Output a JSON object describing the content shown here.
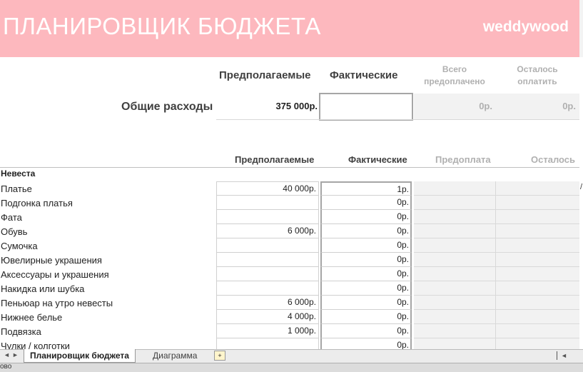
{
  "app": {
    "title": "ПЛАНИРОВЩИК БЮДЖЕТА",
    "brand": "weddywood",
    "banner_color": "#fdb8be"
  },
  "summary": {
    "col_planned": "Предполагаемые",
    "col_actual": "Фактические",
    "col_prepaid": "Всего предоплачено",
    "col_remaining": "Осталось оплатить",
    "row_label": "Общие расходы",
    "planned_total": "375 000р.",
    "actual_total": "",
    "prepaid_total": "0р.",
    "remaining_total": "0р."
  },
  "table": {
    "headers": {
      "planned": "Предполагаемые",
      "actual": "Фактические",
      "prepaid": "Предоплата",
      "remaining": "Осталось"
    },
    "category": "Невеста",
    "rows": [
      {
        "label": "Платье",
        "planned": "40 000р.",
        "actual": "1р."
      },
      {
        "label": "Подгонка платья",
        "planned": "",
        "actual": "0р."
      },
      {
        "label": "Фата",
        "planned": "",
        "actual": "0р."
      },
      {
        "label": "Обувь",
        "planned": "6 000р.",
        "actual": "0р."
      },
      {
        "label": "Сумочка",
        "planned": "",
        "actual": "0р."
      },
      {
        "label": "Ювелирные украшения",
        "planned": "",
        "actual": "0р."
      },
      {
        "label": "Аксессуары и украшения",
        "planned": "",
        "actual": "0р."
      },
      {
        "label": "Накидка или шубка",
        "planned": "",
        "actual": "0р."
      },
      {
        "label": "Пеньюар на утро невесты",
        "planned": "6 000р.",
        "actual": "0р."
      },
      {
        "label": "Нижнее белье",
        "planned": "4 000р.",
        "actual": "0р."
      },
      {
        "label": "Подвязка",
        "planned": "1 000р.",
        "actual": "0р."
      },
      {
        "label": "Чулки / колготки",
        "planned": "",
        "actual": "0р."
      }
    ]
  },
  "sheet_tabs": {
    "nav_first": "◄",
    "nav_last": "►",
    "active": "Планировщик бюджета",
    "other": "Диаграмма",
    "new_tab_icon": "new-sheet-icon"
  },
  "statusbar": {
    "text": "ово"
  },
  "edge_mark": "/"
}
